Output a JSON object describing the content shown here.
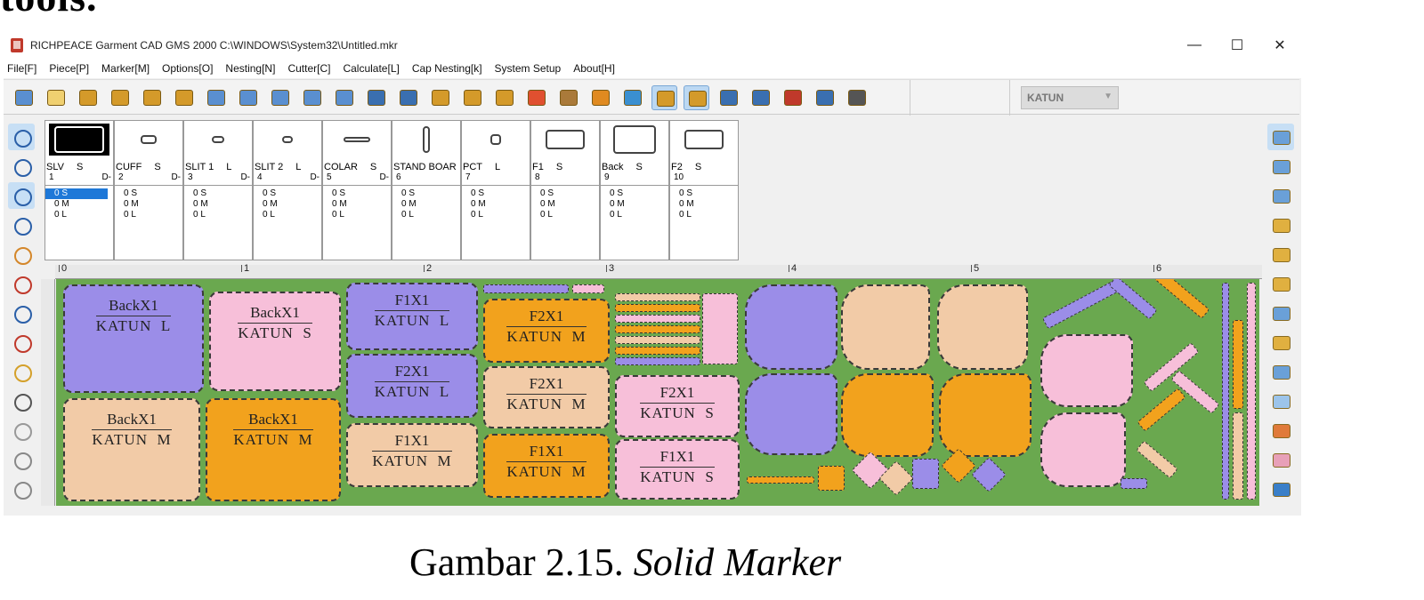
{
  "cropped_heading": "tools.",
  "window": {
    "title": "RICHPEACE Garment CAD GMS 2000 C:\\WINDOWS\\System32\\Untitled.mkr",
    "minimize": "—",
    "maximize": "☐",
    "close": "✕"
  },
  "menu": [
    "File[F]",
    "Piece[P]",
    "Marker[M]",
    "Options[O]",
    "Nesting[N]",
    "Cutter[C]",
    "Calculate[L]",
    "Cap Nesting[k]",
    "System Setup",
    "About[H]"
  ],
  "toolbar": {
    "icons": [
      "open-folder-icon",
      "new-file-icon",
      "open-icon",
      "save-icon",
      "import-icon",
      "export-icon",
      "diamond-icon",
      "window-icon",
      "scanner-icon",
      "frame-icon",
      "preview-icon",
      "undo-icon",
      "redo-icon",
      "arrange-icon",
      "edit-icon",
      "tools-icon",
      "circle-icon",
      "grid-icon",
      "text-icon",
      "image-icon",
      "marker-view-icon",
      "table-view-icon",
      "nest-icon",
      "measure-icon",
      "flip-icon",
      "rotate-icon",
      "delete-icon"
    ],
    "fabric_select": "KATUN"
  },
  "pieces": [
    {
      "name": "SLV",
      "size": "S",
      "index": "1",
      "d": "D-"
    },
    {
      "name": "CUFF",
      "size": "S",
      "index": "2",
      "d": "D-"
    },
    {
      "name": "SLIT 1",
      "size": "L",
      "index": "3",
      "d": "D-"
    },
    {
      "name": "SLIT 2",
      "size": "L",
      "index": "4",
      "d": "D-"
    },
    {
      "name": "COLAR",
      "size": "S",
      "index": "5",
      "d": "D-"
    },
    {
      "name": "STAND BOAR",
      "size": "",
      "index": "6",
      "d": ""
    },
    {
      "name": "PCT",
      "size": "L",
      "index": "7",
      "d": ""
    },
    {
      "name": "F1",
      "size": "S",
      "index": "8",
      "d": ""
    },
    {
      "name": "Back",
      "size": "S",
      "index": "9",
      "d": ""
    },
    {
      "name": "F2",
      "size": "S",
      "index": "10",
      "d": ""
    }
  ],
  "size_rows": [
    "0 S",
    "0 M",
    "0 L"
  ],
  "ruler": [
    "0",
    "1",
    "2",
    "3",
    "4",
    "5",
    "6"
  ],
  "marker_pieces": [
    {
      "name": "BackX1",
      "fabric": "KATUN",
      "size": "L"
    },
    {
      "name": "BackX1",
      "fabric": "KATUN",
      "size": "S"
    },
    {
      "name": "F1X1",
      "fabric": "KATUN",
      "size": "L"
    },
    {
      "name": "F2X1",
      "fabric": "KATUN",
      "size": "M"
    },
    {
      "name": "F2X1",
      "fabric": "KATUN",
      "size": "L"
    },
    {
      "name": "F2X1",
      "fabric": "KATUN",
      "size": "M"
    },
    {
      "name": "F2X1",
      "fabric": "KATUN",
      "size": "S"
    },
    {
      "name": "BackX1",
      "fabric": "KATUN",
      "size": "M"
    },
    {
      "name": "BackX1",
      "fabric": "KATUN",
      "size": "M"
    },
    {
      "name": "F1X1",
      "fabric": "KATUN",
      "size": "M"
    },
    {
      "name": "F1X1",
      "fabric": "KATUN",
      "size": "M"
    },
    {
      "name": "F1X1",
      "fabric": "KATUN",
      "size": "S"
    }
  ],
  "caption": {
    "prefix": "Gambar 2.15.",
    "italic": "Solid Marker"
  }
}
